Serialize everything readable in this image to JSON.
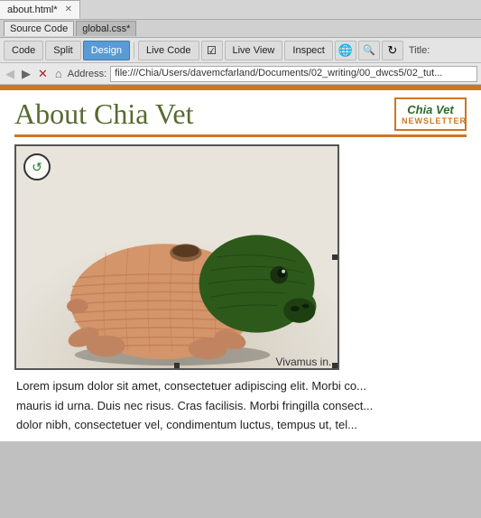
{
  "tabs": [
    {
      "label": "about.html*",
      "active": true,
      "closeable": true
    },
    {
      "label": "global.css*",
      "active": false,
      "closeable": false
    }
  ],
  "source_tabs": [
    {
      "label": "Source Code",
      "active": true
    },
    {
      "label": "global.css*",
      "active": false
    }
  ],
  "toolbar": {
    "code_label": "Code",
    "split_label": "Split",
    "design_label": "Design",
    "live_code_label": "Live Code",
    "live_view_label": "Live View",
    "inspect_label": "Inspect",
    "title_label": "Title:"
  },
  "address": {
    "label": "Address:",
    "url": "file:///Chia/Users/davemcfarland/Documents/02_writing/00_dwcs5/02_tut..."
  },
  "page": {
    "title": "About Chia Vet",
    "newsletter_brand": "Chia Vet",
    "newsletter_sub": "NEWSLETTER",
    "vivamus_text": "Vivamus in...",
    "body_text_1": "Lorem ipsum dolor sit amet, consectetuer adipiscing elit. Morbi co...",
    "body_text_2": "mauris id urna. Duis nec risus. Cras facilisis. Morbi fringilla consect...",
    "body_text_3": "dolor nibh, consectetuer vel, condimentum luctus, tempus ut, tel..."
  },
  "colors": {
    "orange": "#cc7722",
    "green_title": "#556b2f",
    "blue_active": "#5b9bd5"
  }
}
